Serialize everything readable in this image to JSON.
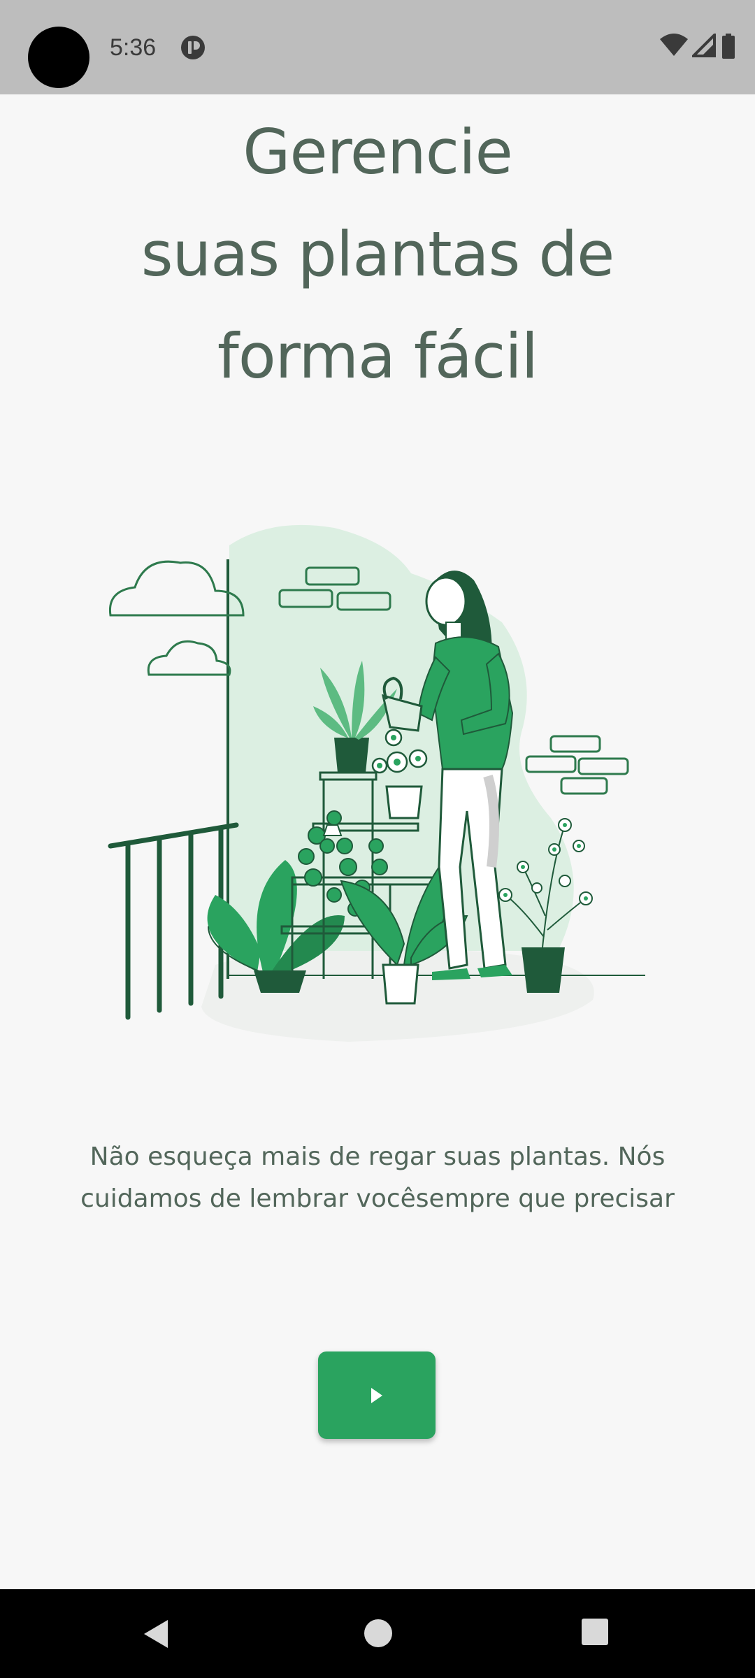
{
  "status_bar": {
    "time": "5:36"
  },
  "onboarding": {
    "headline": [
      "Gerencie",
      "suas plantas de",
      "forma fácil"
    ],
    "description": "Não esqueça mais de regar suas plantas. Nós cuidamos de lembrar vocêsempre que precisar",
    "next_button_icon": "play-arrow-icon",
    "accent_color": "#2aa35f",
    "text_color": "#52665a"
  },
  "navigation_bar": {
    "buttons": [
      "back-icon",
      "home-icon",
      "recents-icon"
    ]
  }
}
